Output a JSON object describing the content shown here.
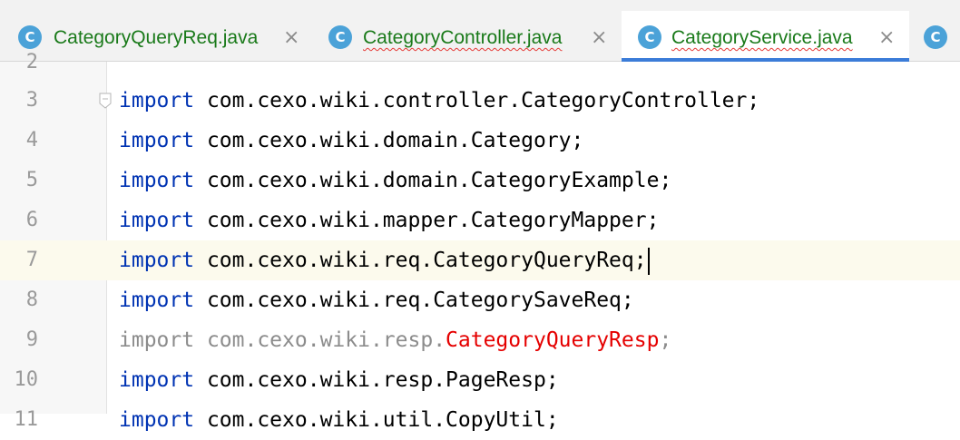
{
  "tabs": [
    {
      "icon": "C",
      "label": "CategoryQueryReq.java",
      "close": "×",
      "active": false
    },
    {
      "icon": "C",
      "label": "CategoryController.java",
      "close": "×",
      "active": false
    },
    {
      "icon": "C",
      "label": "CategoryService.java",
      "close": "×",
      "active": true
    },
    {
      "icon": "C",
      "label": "",
      "close": "",
      "active": false
    }
  ],
  "editor": {
    "current_line": 7,
    "lines": [
      {
        "number": "2",
        "keyword": "",
        "text": "",
        "error_part": "",
        "tail": ""
      },
      {
        "number": "3",
        "keyword": "import",
        "text": " com.cexo.wiki.controller.CategoryController;",
        "error_part": "",
        "tail": ""
      },
      {
        "number": "4",
        "keyword": "import",
        "text": " com.cexo.wiki.domain.Category;",
        "error_part": "",
        "tail": ""
      },
      {
        "number": "5",
        "keyword": "import",
        "text": " com.cexo.wiki.domain.CategoryExample;",
        "error_part": "",
        "tail": ""
      },
      {
        "number": "6",
        "keyword": "import",
        "text": " com.cexo.wiki.mapper.CategoryMapper;",
        "error_part": "",
        "tail": ""
      },
      {
        "number": "7",
        "keyword": "import",
        "text": " com.cexo.wiki.req.CategoryQueryReq;",
        "error_part": "",
        "tail": ""
      },
      {
        "number": "8",
        "keyword": "import",
        "text": " com.cexo.wiki.req.CategorySaveReq;",
        "error_part": "",
        "tail": ""
      },
      {
        "number": "9",
        "keyword": "import",
        "text": " com.cexo.wiki.resp.",
        "error_part": "CategoryQueryResp",
        "tail": ";"
      },
      {
        "number": "10",
        "keyword": "import",
        "text": " com.cexo.wiki.resp.PageResp;",
        "error_part": "",
        "tail": ""
      },
      {
        "number": "11",
        "keyword": "import",
        "text": " com.cexo.wiki.util.CopyUtil;",
        "error_part": "",
        "tail": ""
      }
    ]
  }
}
